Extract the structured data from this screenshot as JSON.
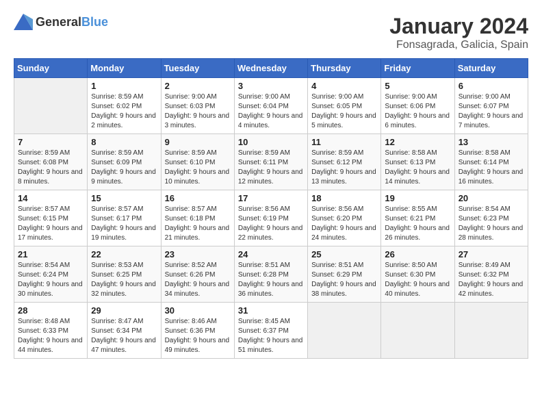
{
  "header": {
    "logo_general": "General",
    "logo_blue": "Blue",
    "month_title": "January 2024",
    "location": "Fonsagrada, Galicia, Spain"
  },
  "weekdays": [
    "Sunday",
    "Monday",
    "Tuesday",
    "Wednesday",
    "Thursday",
    "Friday",
    "Saturday"
  ],
  "weeks": [
    [
      {
        "day": "",
        "sunrise": "",
        "sunset": "",
        "daylight": ""
      },
      {
        "day": "1",
        "sunrise": "Sunrise: 8:59 AM",
        "sunset": "Sunset: 6:02 PM",
        "daylight": "Daylight: 9 hours and 2 minutes."
      },
      {
        "day": "2",
        "sunrise": "Sunrise: 9:00 AM",
        "sunset": "Sunset: 6:03 PM",
        "daylight": "Daylight: 9 hours and 3 minutes."
      },
      {
        "day": "3",
        "sunrise": "Sunrise: 9:00 AM",
        "sunset": "Sunset: 6:04 PM",
        "daylight": "Daylight: 9 hours and 4 minutes."
      },
      {
        "day": "4",
        "sunrise": "Sunrise: 9:00 AM",
        "sunset": "Sunset: 6:05 PM",
        "daylight": "Daylight: 9 hours and 5 minutes."
      },
      {
        "day": "5",
        "sunrise": "Sunrise: 9:00 AM",
        "sunset": "Sunset: 6:06 PM",
        "daylight": "Daylight: 9 hours and 6 minutes."
      },
      {
        "day": "6",
        "sunrise": "Sunrise: 9:00 AM",
        "sunset": "Sunset: 6:07 PM",
        "daylight": "Daylight: 9 hours and 7 minutes."
      }
    ],
    [
      {
        "day": "7",
        "sunrise": "Sunrise: 8:59 AM",
        "sunset": "Sunset: 6:08 PM",
        "daylight": "Daylight: 9 hours and 8 minutes."
      },
      {
        "day": "8",
        "sunrise": "Sunrise: 8:59 AM",
        "sunset": "Sunset: 6:09 PM",
        "daylight": "Daylight: 9 hours and 9 minutes."
      },
      {
        "day": "9",
        "sunrise": "Sunrise: 8:59 AM",
        "sunset": "Sunset: 6:10 PM",
        "daylight": "Daylight: 9 hours and 10 minutes."
      },
      {
        "day": "10",
        "sunrise": "Sunrise: 8:59 AM",
        "sunset": "Sunset: 6:11 PM",
        "daylight": "Daylight: 9 hours and 12 minutes."
      },
      {
        "day": "11",
        "sunrise": "Sunrise: 8:59 AM",
        "sunset": "Sunset: 6:12 PM",
        "daylight": "Daylight: 9 hours and 13 minutes."
      },
      {
        "day": "12",
        "sunrise": "Sunrise: 8:58 AM",
        "sunset": "Sunset: 6:13 PM",
        "daylight": "Daylight: 9 hours and 14 minutes."
      },
      {
        "day": "13",
        "sunrise": "Sunrise: 8:58 AM",
        "sunset": "Sunset: 6:14 PM",
        "daylight": "Daylight: 9 hours and 16 minutes."
      }
    ],
    [
      {
        "day": "14",
        "sunrise": "Sunrise: 8:57 AM",
        "sunset": "Sunset: 6:15 PM",
        "daylight": "Daylight: 9 hours and 17 minutes."
      },
      {
        "day": "15",
        "sunrise": "Sunrise: 8:57 AM",
        "sunset": "Sunset: 6:17 PM",
        "daylight": "Daylight: 9 hours and 19 minutes."
      },
      {
        "day": "16",
        "sunrise": "Sunrise: 8:57 AM",
        "sunset": "Sunset: 6:18 PM",
        "daylight": "Daylight: 9 hours and 21 minutes."
      },
      {
        "day": "17",
        "sunrise": "Sunrise: 8:56 AM",
        "sunset": "Sunset: 6:19 PM",
        "daylight": "Daylight: 9 hours and 22 minutes."
      },
      {
        "day": "18",
        "sunrise": "Sunrise: 8:56 AM",
        "sunset": "Sunset: 6:20 PM",
        "daylight": "Daylight: 9 hours and 24 minutes."
      },
      {
        "day": "19",
        "sunrise": "Sunrise: 8:55 AM",
        "sunset": "Sunset: 6:21 PM",
        "daylight": "Daylight: 9 hours and 26 minutes."
      },
      {
        "day": "20",
        "sunrise": "Sunrise: 8:54 AM",
        "sunset": "Sunset: 6:23 PM",
        "daylight": "Daylight: 9 hours and 28 minutes."
      }
    ],
    [
      {
        "day": "21",
        "sunrise": "Sunrise: 8:54 AM",
        "sunset": "Sunset: 6:24 PM",
        "daylight": "Daylight: 9 hours and 30 minutes."
      },
      {
        "day": "22",
        "sunrise": "Sunrise: 8:53 AM",
        "sunset": "Sunset: 6:25 PM",
        "daylight": "Daylight: 9 hours and 32 minutes."
      },
      {
        "day": "23",
        "sunrise": "Sunrise: 8:52 AM",
        "sunset": "Sunset: 6:26 PM",
        "daylight": "Daylight: 9 hours and 34 minutes."
      },
      {
        "day": "24",
        "sunrise": "Sunrise: 8:51 AM",
        "sunset": "Sunset: 6:28 PM",
        "daylight": "Daylight: 9 hours and 36 minutes."
      },
      {
        "day": "25",
        "sunrise": "Sunrise: 8:51 AM",
        "sunset": "Sunset: 6:29 PM",
        "daylight": "Daylight: 9 hours and 38 minutes."
      },
      {
        "day": "26",
        "sunrise": "Sunrise: 8:50 AM",
        "sunset": "Sunset: 6:30 PM",
        "daylight": "Daylight: 9 hours and 40 minutes."
      },
      {
        "day": "27",
        "sunrise": "Sunrise: 8:49 AM",
        "sunset": "Sunset: 6:32 PM",
        "daylight": "Daylight: 9 hours and 42 minutes."
      }
    ],
    [
      {
        "day": "28",
        "sunrise": "Sunrise: 8:48 AM",
        "sunset": "Sunset: 6:33 PM",
        "daylight": "Daylight: 9 hours and 44 minutes."
      },
      {
        "day": "29",
        "sunrise": "Sunrise: 8:47 AM",
        "sunset": "Sunset: 6:34 PM",
        "daylight": "Daylight: 9 hours and 47 minutes."
      },
      {
        "day": "30",
        "sunrise": "Sunrise: 8:46 AM",
        "sunset": "Sunset: 6:36 PM",
        "daylight": "Daylight: 9 hours and 49 minutes."
      },
      {
        "day": "31",
        "sunrise": "Sunrise: 8:45 AM",
        "sunset": "Sunset: 6:37 PM",
        "daylight": "Daylight: 9 hours and 51 minutes."
      },
      {
        "day": "",
        "sunrise": "",
        "sunset": "",
        "daylight": ""
      },
      {
        "day": "",
        "sunrise": "",
        "sunset": "",
        "daylight": ""
      },
      {
        "day": "",
        "sunrise": "",
        "sunset": "",
        "daylight": ""
      }
    ]
  ]
}
